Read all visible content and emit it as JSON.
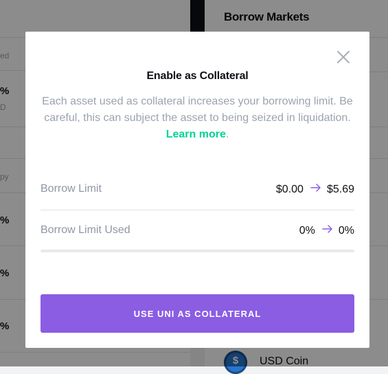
{
  "background": {
    "left_partial": {
      "header_fragment": "ed",
      "value_fragments": [
        "%",
        "D"
      ],
      "subheader_fragment": "py",
      "percent_fragments": [
        "%",
        "%",
        "%"
      ]
    },
    "right_panel": {
      "title": "Borrow Markets",
      "visible_asset": {
        "name": "USD Coin",
        "icon": "usdc-coin-icon"
      }
    }
  },
  "modal": {
    "title": "Enable as Collateral",
    "description": "Each asset used as collateral increases your borrowing limit. Be careful, this can subject the asset to being seized in liquidation.",
    "learn_more": "Learn more",
    "description_end": ".",
    "close_icon": "close-icon",
    "accent_color": "#8a5de3",
    "link_color": "#00d395",
    "stats": [
      {
        "label": "Borrow Limit",
        "from": "$0.00",
        "to": "$5.69",
        "arrow_icon": "arrow-right-icon"
      },
      {
        "label": "Borrow Limit Used",
        "from": "0%",
        "to": "0%",
        "arrow_icon": "arrow-right-icon"
      }
    ],
    "borrow_limit_used_progress": 0,
    "cta_label": "USE UNI AS COLLATERAL"
  }
}
